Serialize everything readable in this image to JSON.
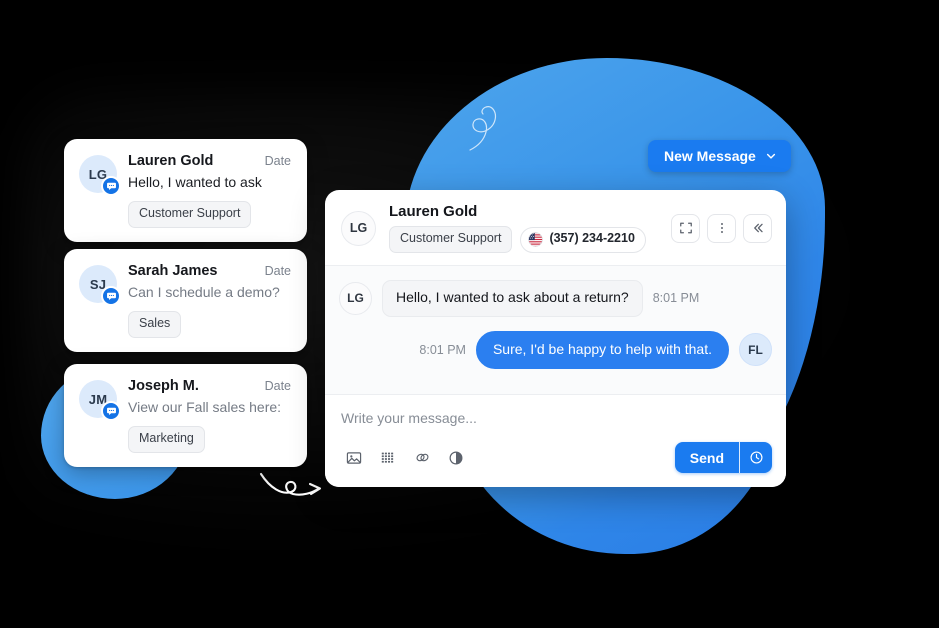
{
  "colors": {
    "accent": "#1a7bf0",
    "bubble_out": "#2b7ff0",
    "blob_light": "#4ea5ec",
    "blob_dark": "#2a7de6",
    "background": "#000000",
    "card_bg": "#ffffff",
    "chip_bg": "#f4f5f7"
  },
  "decor": {
    "squiggle": "spiral-flourish",
    "curly_arrow": "curly-arrow-right",
    "blob_main": "blue-blob-shape",
    "blob_small": "blue-blob-small"
  },
  "inbox": {
    "cards": [
      {
        "initials": "LG",
        "name": "Lauren Gold",
        "date": "Date",
        "preview": "Hello, I wanted to ask",
        "tag": "Customer Support",
        "unread": true,
        "badge_icon": "chat-bubble-icon"
      },
      {
        "initials": "SJ",
        "name": "Sarah James",
        "date": "Date",
        "preview": "Can I schedule a demo?",
        "tag": "Sales",
        "unread": false,
        "badge_icon": "chat-bubble-icon"
      },
      {
        "initials": "JM",
        "name": "Joseph M.",
        "date": "Date",
        "preview": "View our Fall sales here:",
        "tag": "Marketing",
        "unread": false,
        "badge_icon": "chat-bubble-icon"
      }
    ]
  },
  "new_message_button": {
    "label": "New Message",
    "chevron_icon": "chevron-down-icon"
  },
  "chat": {
    "header": {
      "initials": "LG",
      "name": "Lauren Gold",
      "tag": "Customer Support",
      "phone": "(357) 234-2210",
      "flag_icon": "us-flag-icon",
      "actions": [
        {
          "name": "expand-button",
          "icon": "expand-icon"
        },
        {
          "name": "more-options-button",
          "icon": "more-vertical-icon"
        },
        {
          "name": "collapse-button",
          "icon": "chevrons-left-icon"
        }
      ]
    },
    "messages": [
      {
        "direction": "in",
        "initials": "LG",
        "text": "Hello, I wanted to ask about a return?",
        "time": "8:01 PM"
      },
      {
        "direction": "out",
        "initials": "FL",
        "text": "Sure, I'd be happy to help with that.",
        "time": "8:01 PM"
      }
    ],
    "composer": {
      "placeholder": "Write your message...",
      "tools": [
        {
          "name": "insert-image-button",
          "icon": "image-icon"
        },
        {
          "name": "insert-template-button",
          "icon": "grid-icon"
        },
        {
          "name": "insert-link-button",
          "icon": "link-icon"
        },
        {
          "name": "contrast-button",
          "icon": "half-circle-icon"
        }
      ],
      "send_label": "Send",
      "schedule_icon": "clock-icon"
    }
  }
}
